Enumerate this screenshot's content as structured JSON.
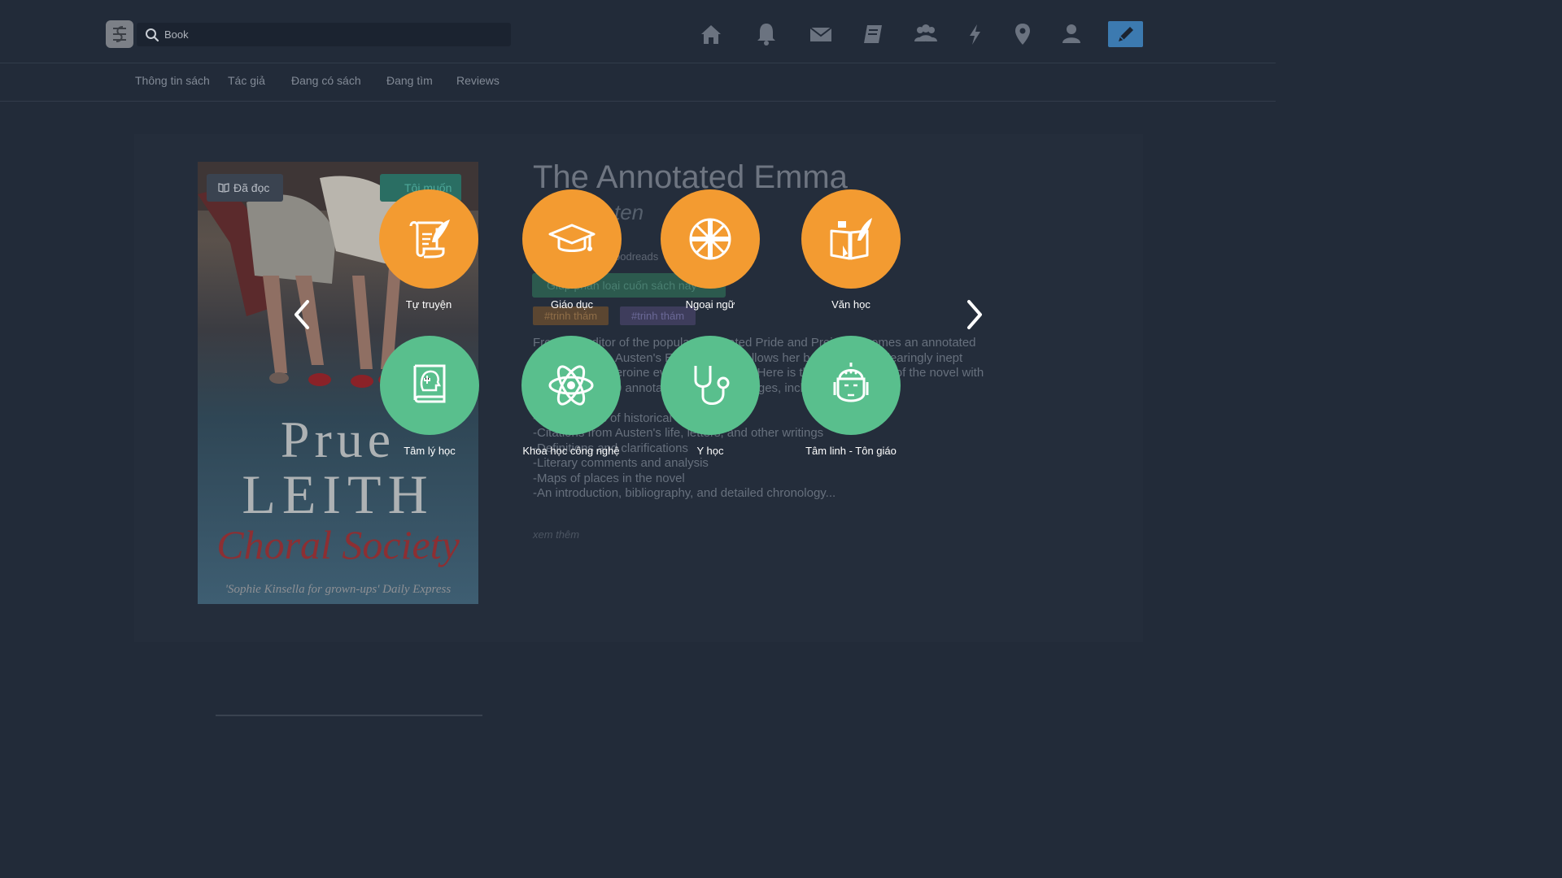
{
  "header": {
    "search_placeholder": "Book",
    "icons": [
      "home-icon",
      "bell-icon",
      "mail-icon",
      "book-icon",
      "group-icon",
      "bolt-icon",
      "location-icon",
      "user-icon",
      "pencil-icon"
    ]
  },
  "tabs": [
    "Thông tin sách",
    "Tác giả",
    "Đang có sách",
    "Đang tìm",
    "Reviews"
  ],
  "book": {
    "read_label": "Đã đọc",
    "want_label": "Tôi muốn",
    "title": "The Annotated Emma",
    "author_fragment": "ten",
    "goodreads_fragment": "oodreads",
    "classify_label": "Giúp phân loại cuốn sách này",
    "tags": [
      "#trinh thám",
      "#trinh thám"
    ],
    "cover_author_line1": "Prue",
    "cover_author_line2": "LEITH",
    "cover_title": "Choral Society",
    "cover_quote": "'Sophie Kinsella for grown-ups' Daily Express",
    "description_lines": [
      "From the editor of the popular Annotated Pride and Prejudice comes an annotated",
      "edition of Jane Austen's Emma, which follows her beloved but endearingly inept",
      "matchmaking heroine even more closely. Here is the complete text of the novel with",
      "more than 2,000 annotations on facing pages, including:",
      "",
      "-Explanations of historical context",
      "-Citations from Austen's life, letters, and other writings",
      "-Definitions and clarifications",
      "-Literary comments and analysis",
      "-Maps of places in the novel",
      "-An introduction, bibliography, and detailed chronology..."
    ],
    "more_label": "xem thêm"
  },
  "categories": [
    {
      "label": "Tự truyện",
      "icon": "scroll-quill-icon",
      "color": "#f39b31"
    },
    {
      "label": "Giáo dục",
      "icon": "graduation-cap-icon",
      "color": "#f39b31"
    },
    {
      "label": "Ngoại ngữ",
      "icon": "union-jack-icon",
      "color": "#f39b31"
    },
    {
      "label": "Văn học",
      "icon": "book-quill-icon",
      "color": "#f39b31"
    },
    {
      "label": "Tâm lý học",
      "icon": "psychology-book-icon",
      "color": "#59bf8d"
    },
    {
      "label": "Khoa học công nghệ",
      "icon": "atom-icon",
      "color": "#59bf8d"
    },
    {
      "label": "Y học",
      "icon": "stethoscope-icon",
      "color": "#59bf8d"
    },
    {
      "label": "Tâm linh - Tôn giáo",
      "icon": "buddha-icon",
      "color": "#59bf8d"
    }
  ]
}
